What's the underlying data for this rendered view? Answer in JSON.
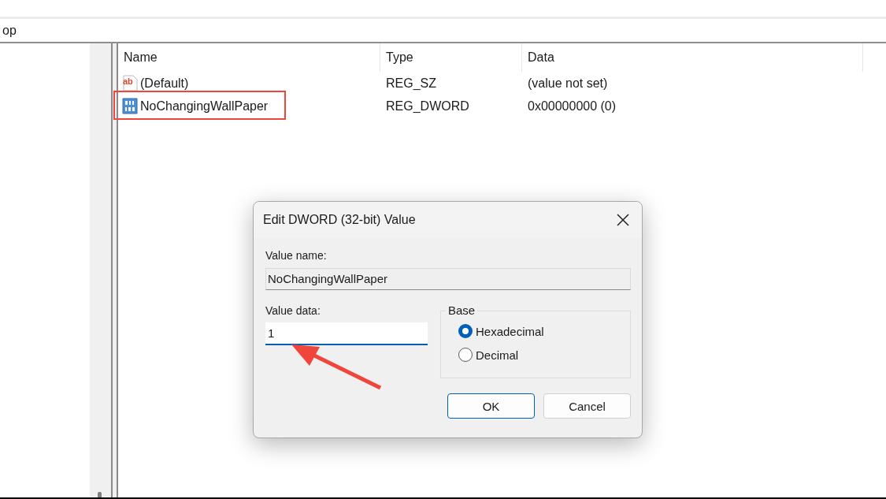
{
  "address_bar": {
    "text": "op"
  },
  "list": {
    "columns": [
      "Name",
      "Type",
      "Data"
    ],
    "rows": [
      {
        "kind": "string",
        "icon_text": "ab",
        "name": "(Default)",
        "type": "REG_SZ",
        "data": "(value not set)",
        "highlighted": false
      },
      {
        "kind": "dword",
        "name": "NoChangingWallPaper",
        "type": "REG_DWORD",
        "data": "0x00000000 (0)",
        "highlighted": true
      }
    ]
  },
  "dialog": {
    "title": "Edit DWORD (32-bit) Value",
    "value_name_label": "Value name:",
    "value_name": "NoChangingWallPaper",
    "value_data_label": "Value data:",
    "value_data": "1",
    "base_label": "Base",
    "bases": [
      {
        "label": "Hexadecimal",
        "selected": true
      },
      {
        "label": "Decimal",
        "selected": false
      }
    ],
    "buttons": [
      "OK",
      "Cancel"
    ]
  }
}
